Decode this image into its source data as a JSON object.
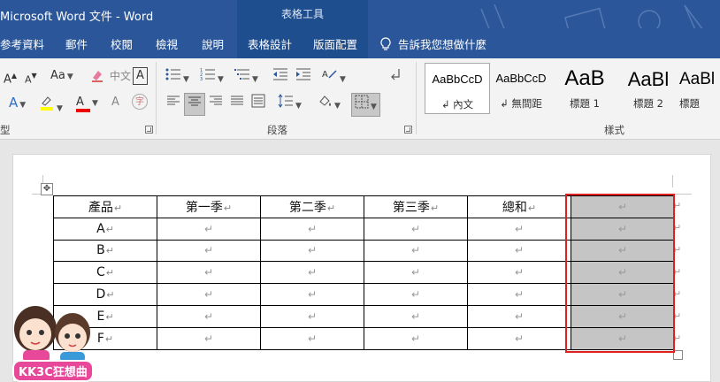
{
  "window": {
    "title": "Microsoft Word 文件 - Word",
    "contextual_group": "表格工具"
  },
  "tabs": [
    {
      "label": "参考資料"
    },
    {
      "label": "郵件"
    },
    {
      "label": "校閱"
    },
    {
      "label": "檢視"
    },
    {
      "label": "說明"
    },
    {
      "label": "表格設計"
    },
    {
      "label": "版面配置"
    }
  ],
  "tell_me": "告訴我您想做什麼",
  "ribbon": {
    "groups": {
      "font_partial": "型",
      "paragraph": "段落",
      "styles": "樣式"
    },
    "font_controls": {
      "grow": "A",
      "shrink": "A",
      "case": "Aa",
      "phonetic": "中文",
      "char_border": "A",
      "enclose": "字"
    },
    "styles": [
      {
        "sample": "AaBbCcD",
        "name": "↲ 內文"
      },
      {
        "sample": "AaBbCcD",
        "name": "↲ 無間距"
      },
      {
        "sample": "AaB",
        "name": "標題 1"
      },
      {
        "sample": "AaBl",
        "name": "標題 2"
      },
      {
        "sample": "AaBl",
        "name": "標題"
      }
    ]
  },
  "table": {
    "headers": [
      "產品",
      "第一季",
      "第二季",
      "第三季",
      "總和",
      ""
    ],
    "rows": [
      {
        "label": "A"
      },
      {
        "label": "B"
      },
      {
        "label": "C"
      },
      {
        "label": "D"
      },
      {
        "label": "E"
      },
      {
        "label": "F"
      }
    ],
    "paragraph_mark": "↵"
  },
  "logo": {
    "text": "KK3C狂想曲"
  },
  "colors": {
    "title_bar": "#2b579a",
    "selection_highlight": "#c5c5c5",
    "annotation_box": "#e02020"
  }
}
